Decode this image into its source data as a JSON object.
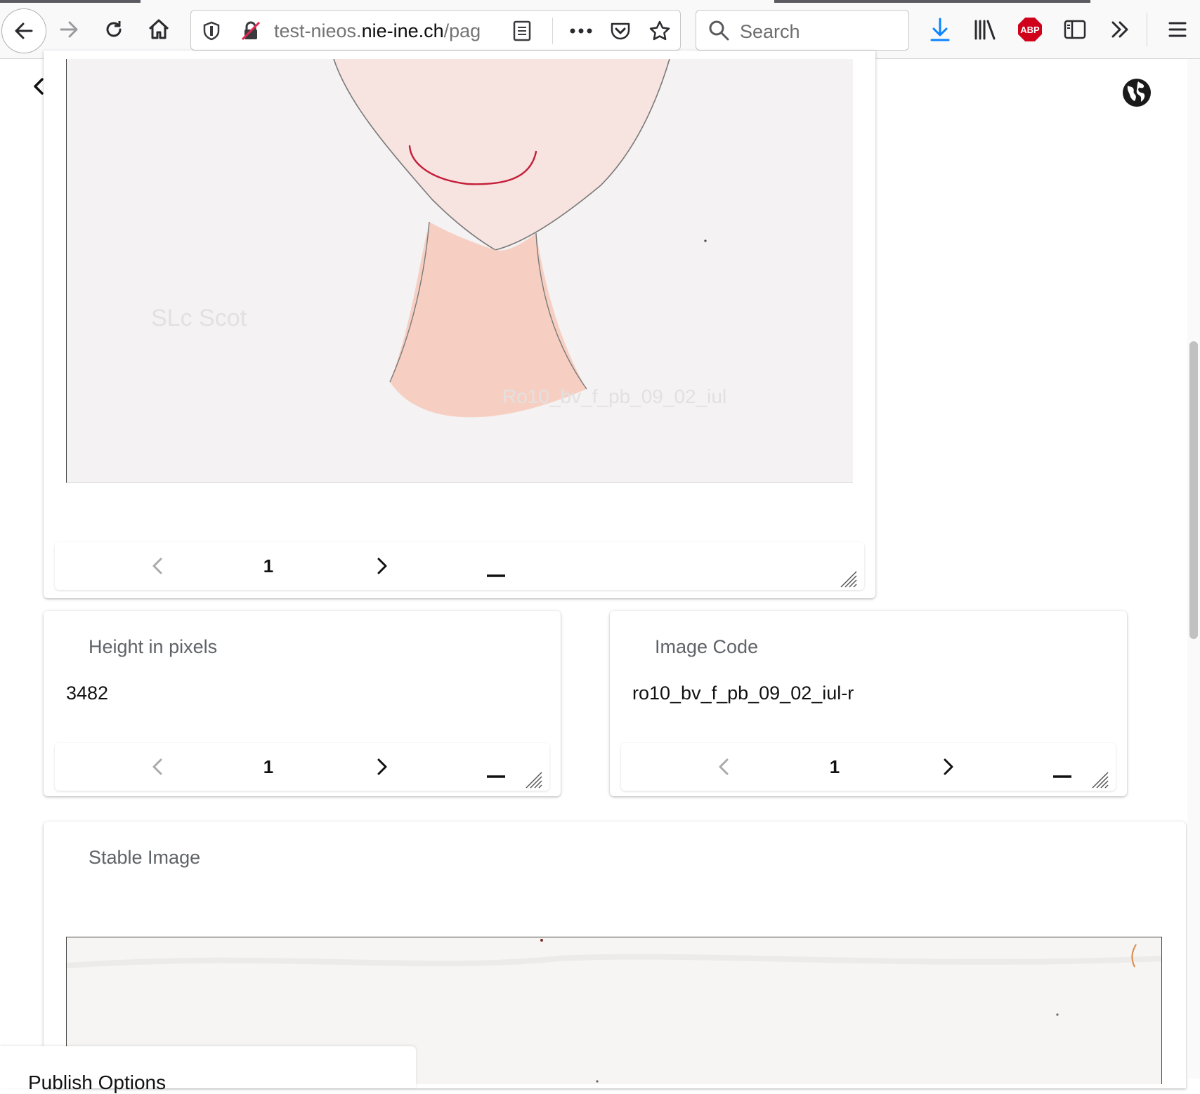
{
  "browser": {
    "url_domain_prefix": "test-nieos.",
    "url_domain": "nie-ine.ch",
    "url_path": "/pag",
    "search_placeholder": "Search",
    "abp_label": "ABP"
  },
  "main_image_card": {
    "pager": {
      "page": "1"
    }
  },
  "height_card": {
    "title": "Height in pixels",
    "value": "3482",
    "pager": {
      "page": "1"
    }
  },
  "image_code_card": {
    "title": "Image Code",
    "value": "ro10_bv_f_pb_09_02_iul-r",
    "pager": {
      "page": "1"
    }
  },
  "stable_image_card": {
    "title": "Stable Image"
  },
  "publish_panel": {
    "label": "Publish Options"
  }
}
